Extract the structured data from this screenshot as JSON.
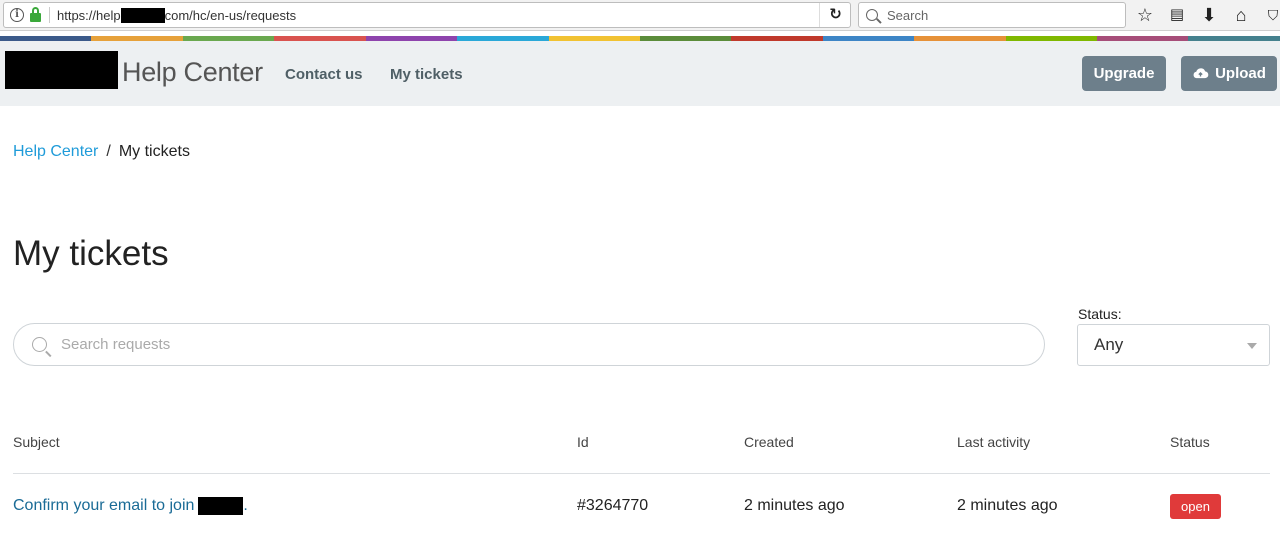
{
  "browser": {
    "url_prefix": "https://help",
    "url_suffix": "com/hc/en-us/requests",
    "search_placeholder": "Search"
  },
  "header": {
    "brand": "Help Center",
    "nav": [
      "Contact us",
      "My tickets"
    ],
    "upgrade_label": "Upgrade",
    "upload_label": "Upload"
  },
  "breadcrumb": {
    "home": "Help Center",
    "separator": "/",
    "current": "My tickets"
  },
  "page": {
    "title": "My tickets",
    "search_placeholder": "Search requests",
    "status_label": "Status:",
    "status_value": "Any"
  },
  "table": {
    "headers": [
      "Subject",
      "Id",
      "Created",
      "Last activity",
      "Status"
    ],
    "rows": [
      {
        "subject_prefix": "Confirm your email to join",
        "subject_suffix": ".",
        "id": "#3264770",
        "created": "2 minutes ago",
        "last_activity": "2 minutes ago",
        "status": "open"
      }
    ]
  },
  "colors": {
    "stripe": [
      "#3b5a8a",
      "#e6a13a",
      "#6aa84f",
      "#d9534f",
      "#8e44ad",
      "#2aa8d8",
      "#f1c232",
      "#5b8c3a",
      "#c0392b",
      "#3d85c6",
      "#e69138",
      "#7fb800",
      "#a64d79",
      "#45818e"
    ],
    "accent_link": "#1f9bd9",
    "button_bg": "#6d7f8b",
    "status_open": "#e03a3a"
  }
}
